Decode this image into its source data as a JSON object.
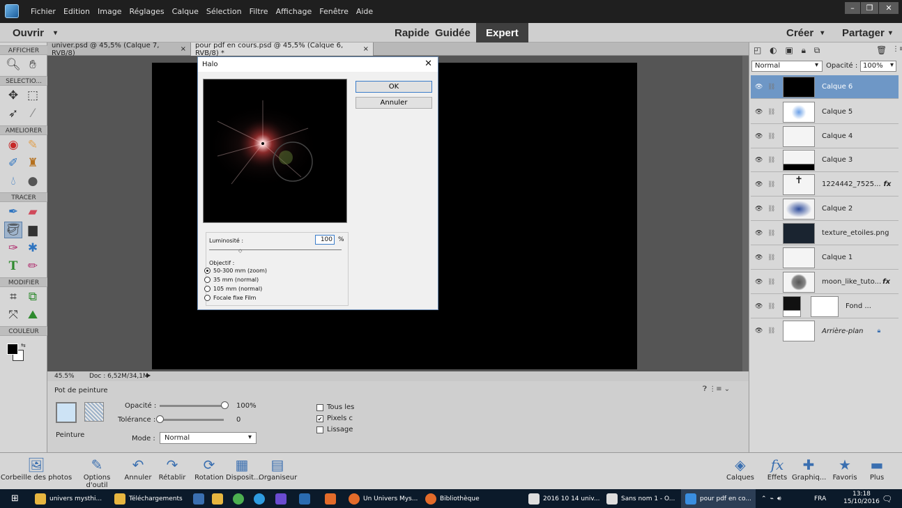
{
  "menubar": {
    "items": [
      "Fichier",
      "Edition",
      "Image",
      "Réglages",
      "Calque",
      "Sélection",
      "Filtre",
      "Affichage",
      "Fenêtre",
      "Aide"
    ]
  },
  "modebar": {
    "open": "Ouvrir",
    "modes": [
      "Rapide",
      "Guidée",
      "Expert"
    ],
    "active_mode": "Expert",
    "create": "Créer",
    "share": "Partager"
  },
  "toolbar": {
    "sections": [
      "AFFICHER",
      "SELECTIO...",
      "AMELIORER",
      "TRACER",
      "MODIFIER",
      "COULEUR"
    ]
  },
  "tabs": [
    {
      "label": "univer.psd @ 45,5% (Calque 7, RVB/8)",
      "close": "×"
    },
    {
      "label": "pour pdf en cours.psd @ 45,5% (Calque 6, RVB/8) *",
      "close": "×"
    }
  ],
  "status": {
    "zoom": "45.5%",
    "doc": "Doc : 6,52M/34,1M"
  },
  "options": {
    "tool_name": "Pot de peinture",
    "fill_label": "Peinture",
    "opacity_label": "Opacité :",
    "opacity_value": "100%",
    "tolerance_label": "Tolérance :",
    "tolerance_value": "0",
    "mode_label": "Mode :",
    "mode_value": "Normal",
    "check_all": "Tous les",
    "check_pixels": "Pixels c",
    "check_smooth": "Lissage"
  },
  "dialog": {
    "title": "Halo",
    "ok": "OK",
    "cancel": "Annuler",
    "brightness_label": "Luminosité :",
    "brightness_value": "100",
    "brightness_unit": "%",
    "brightness_slider": 1.0,
    "lens_label": "Objectif :",
    "lens_options": [
      "50-300 mm (zoom)",
      "35 mm (normal)",
      "105 mm  (normal)",
      "Focale fixe Film"
    ],
    "lens_selected": "50-300 mm (zoom)"
  },
  "layers_panel": {
    "blend_mode": "Normal",
    "opacity_label": "Opacité :",
    "opacity_value": "100%",
    "layers": [
      {
        "name": "Calque 6",
        "selected": true
      },
      {
        "name": "Calque 5"
      },
      {
        "name": "Calque 4"
      },
      {
        "name": "Calque 3"
      },
      {
        "name": "1224442_7525...",
        "fx": "fx"
      },
      {
        "name": "Calque 2"
      },
      {
        "name": "texture_etoiles.png"
      },
      {
        "name": "Calque 1"
      },
      {
        "name": "moon_like_tuto...",
        "fx": "fx"
      },
      {
        "name": "Fond ..."
      },
      {
        "name": "Arrière-plan"
      }
    ]
  },
  "dock_left": [
    "Corbeille des photos",
    "Options d'outil",
    "Annuler",
    "Rétablir",
    "Rotation",
    "Disposit...",
    "Organiseur"
  ],
  "dock_right": [
    "Calques",
    "Effets",
    "Graphiq...",
    "Favoris",
    "Plus"
  ],
  "taskbar": {
    "apps": [
      "univers mysthi...",
      "Téléchargements",
      "Un Univers Mys...",
      "Bibliothèque",
      "2016 10 14 univ...",
      "Sans nom 1 - O...",
      "pour pdf en co..."
    ],
    "lang": "FRA",
    "time": "13:18",
    "date": "15/10/2016"
  },
  "colors": {
    "selected_layer": "#6e97c6",
    "menubar": "#1f1f1f",
    "canvas": "#000000",
    "taskbar": "#0b1a2a"
  }
}
